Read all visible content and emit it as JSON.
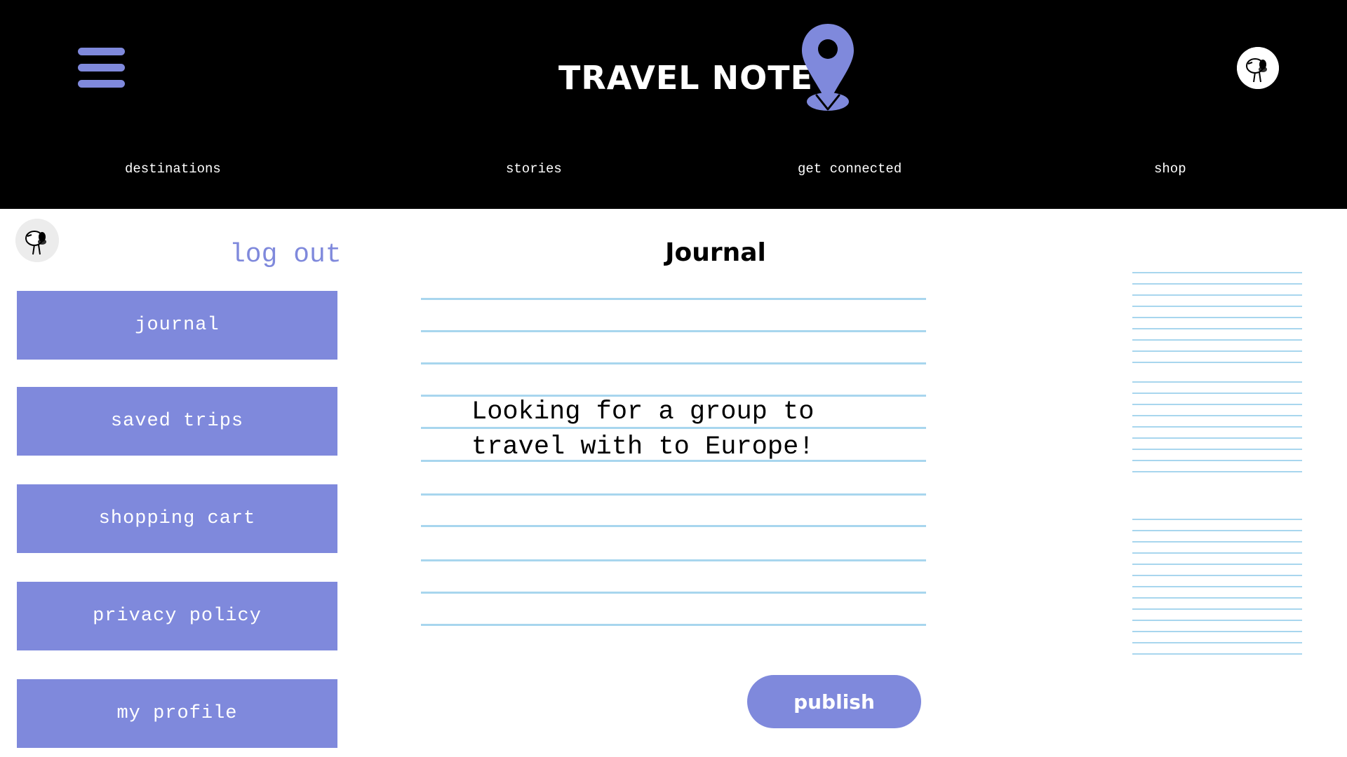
{
  "header": {
    "brand": "TRAVEL NOTE",
    "menu_icon": "hamburger-menu-icon",
    "pin_icon": "map-pin-icon",
    "avatar_icon": "user-avatar-icon",
    "nav": [
      "destinations",
      "stories",
      "get connected",
      "shop"
    ]
  },
  "sidebar": {
    "avatar_icon": "user-avatar-icon",
    "logout_label": "log out",
    "items": [
      "journal",
      "saved trips",
      "shopping cart",
      "privacy policy",
      "my profile"
    ]
  },
  "journal": {
    "title": "Journal",
    "entry_text": "Looking for a group to travel with to Europe!",
    "publish_label": "publish"
  },
  "colors": {
    "accent": "#7f89dc",
    "header_bg": "#000000",
    "rule": "#a8d6ee",
    "text": "#000000"
  }
}
